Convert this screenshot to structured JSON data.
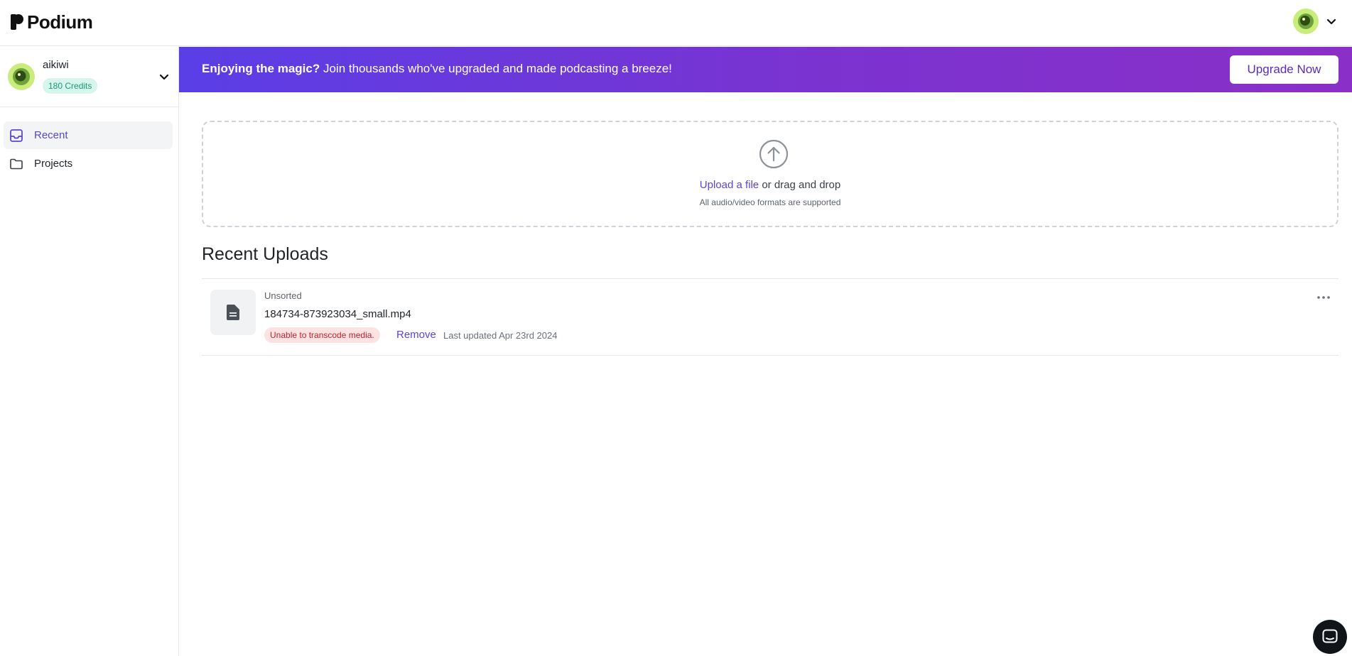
{
  "header": {
    "logo_text": "Podium"
  },
  "sidebar": {
    "account": {
      "name": "aikiwi",
      "credits": "180 Credits"
    },
    "items": [
      {
        "label": "Recent",
        "icon": "inbox-icon",
        "active": true
      },
      {
        "label": "Projects",
        "icon": "folder-icon",
        "active": false
      }
    ]
  },
  "banner": {
    "bold": "Enjoying the magic?",
    "text": " Join thousands who've upgraded and made podcasting a breeze!",
    "button_label": "Upgrade Now"
  },
  "upload": {
    "link_text": "Upload a file",
    "rest_text": " or drag and drop",
    "subtext": "All audio/video formats are supported"
  },
  "recent": {
    "title": "Recent Uploads",
    "items": [
      {
        "category": "Unsorted",
        "filename": "184734-873923034_small.mp4",
        "error": "Unable to transcode media.",
        "remove_label": "Remove",
        "updated": "Last updated Apr 23rd 2024"
      }
    ]
  },
  "colors": {
    "accent": "#5b45d6",
    "banner_start": "#5a3ee6",
    "banner_end": "#8a2fc8",
    "credits_bg": "#d6f5ec",
    "error_bg": "#fde2e2",
    "error_text": "#c0262d"
  }
}
